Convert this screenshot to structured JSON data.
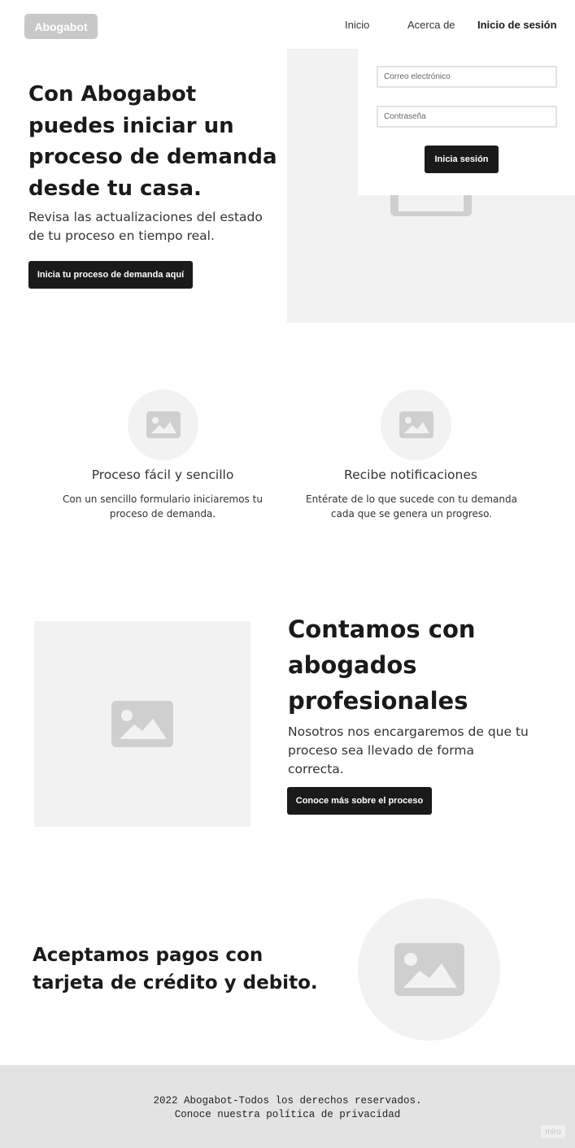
{
  "nav": {
    "logo": "Abogabot",
    "links": [
      "Inicio",
      "Acerca de",
      "Inicio de sesión"
    ]
  },
  "login": {
    "email_placeholder": "Correo electrónico",
    "password_placeholder": "Contraseña",
    "submit_label": "Inicia sesión"
  },
  "hero": {
    "title": "Con Abogabot puedes iniciar un proceso de demanda desde tu casa.",
    "subtitle": "Revisa las actualizaciones del estado de tu proceso en tiempo real.",
    "cta_label": "Inicia tu proceso de demanda aquí"
  },
  "features": [
    {
      "title": "Proceso fácil y sencillo",
      "text": "Con un sencillo formulario iniciaremos tu proceso de demanda.",
      "icon": "image-placeholder-icon"
    },
    {
      "title": "Recibe notificaciones",
      "text": "Entérate de lo que sucede con tu demanda cada que se genera un progreso.",
      "icon": "image-placeholder-icon"
    }
  ],
  "lawyers": {
    "title": "Contamos con abogados profesionales",
    "subtitle": "Nosotros nos encargaremos de que tu proceso sea llevado de forma correcta.",
    "cta_label": "Conoce más sobre el proceso"
  },
  "payments": {
    "title": "Aceptamos pagos con tarjeta de crédito y debito."
  },
  "footer": {
    "line1": "2022 Abogabot-Todos los derechos reservados.",
    "line2": "Conoce nuestra política de privacidad"
  },
  "watermark": "miro",
  "colors": {
    "dark": "#1a1a1a",
    "placeholder_bg": "#f2f2f2",
    "icon_gray": "#cfcfcf",
    "footer_bg": "#e3e3e3"
  }
}
